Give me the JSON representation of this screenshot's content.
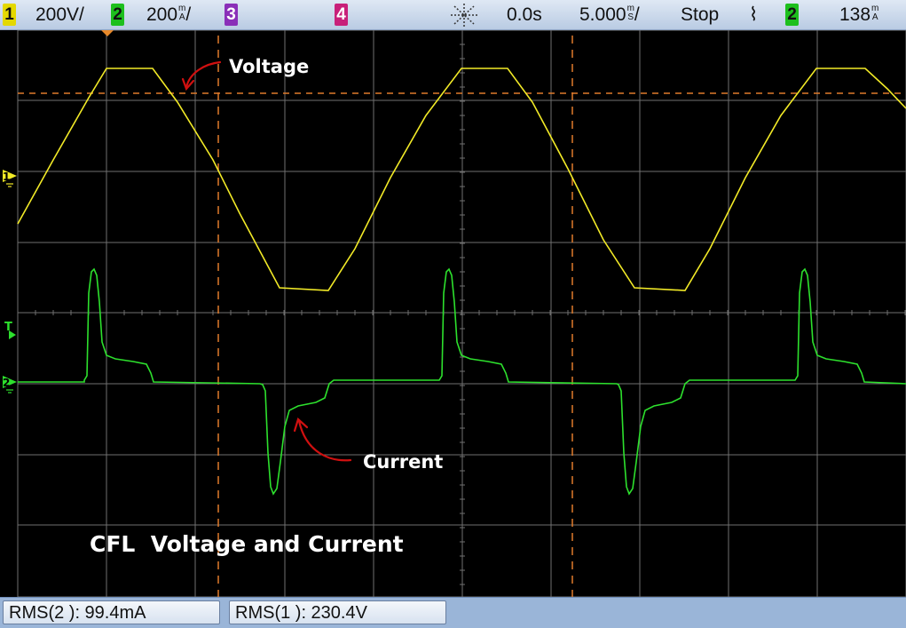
{
  "topbar": {
    "ch1_number": "1",
    "ch1_scale": "200V/",
    "ch2_number": "2",
    "ch2_scale_value": "200",
    "ch2_scale_unit_top": "m",
    "ch2_scale_unit_bottom": "A",
    "ch2_scale_suffix": "/",
    "ch3_number": "3",
    "ch4_number": "4",
    "delay": "0.0s",
    "timebase_value": "5.000",
    "timebase_unit_top": "m",
    "timebase_unit_bottom": "S",
    "timebase_suffix": "/",
    "run_state": "Stop",
    "trigger_slope_symbol": "⌇",
    "trigger_source": "2",
    "trigger_level_value": "138",
    "trigger_level_unit_top": "m",
    "trigger_level_unit_bottom": "A"
  },
  "markers": {
    "ch1_marker": "1",
    "trigger_marker": "T",
    "ch2_marker": "2"
  },
  "annotations": {
    "voltage_label": "Voltage",
    "current_label": "Current",
    "caption": "CFL  Voltage and Current"
  },
  "measurements": {
    "rms2": "RMS(2 ): 99.4mA",
    "rms1": "RMS(1 ): 230.4V"
  },
  "colors": {
    "ch1": "#f2ea27",
    "ch2": "#2de02d",
    "ch3": "#b04bd6",
    "ch4": "#e0308f",
    "cursor": "#e07a2a",
    "annotation_arrow": "#d01010",
    "grid": "#707070"
  }
}
